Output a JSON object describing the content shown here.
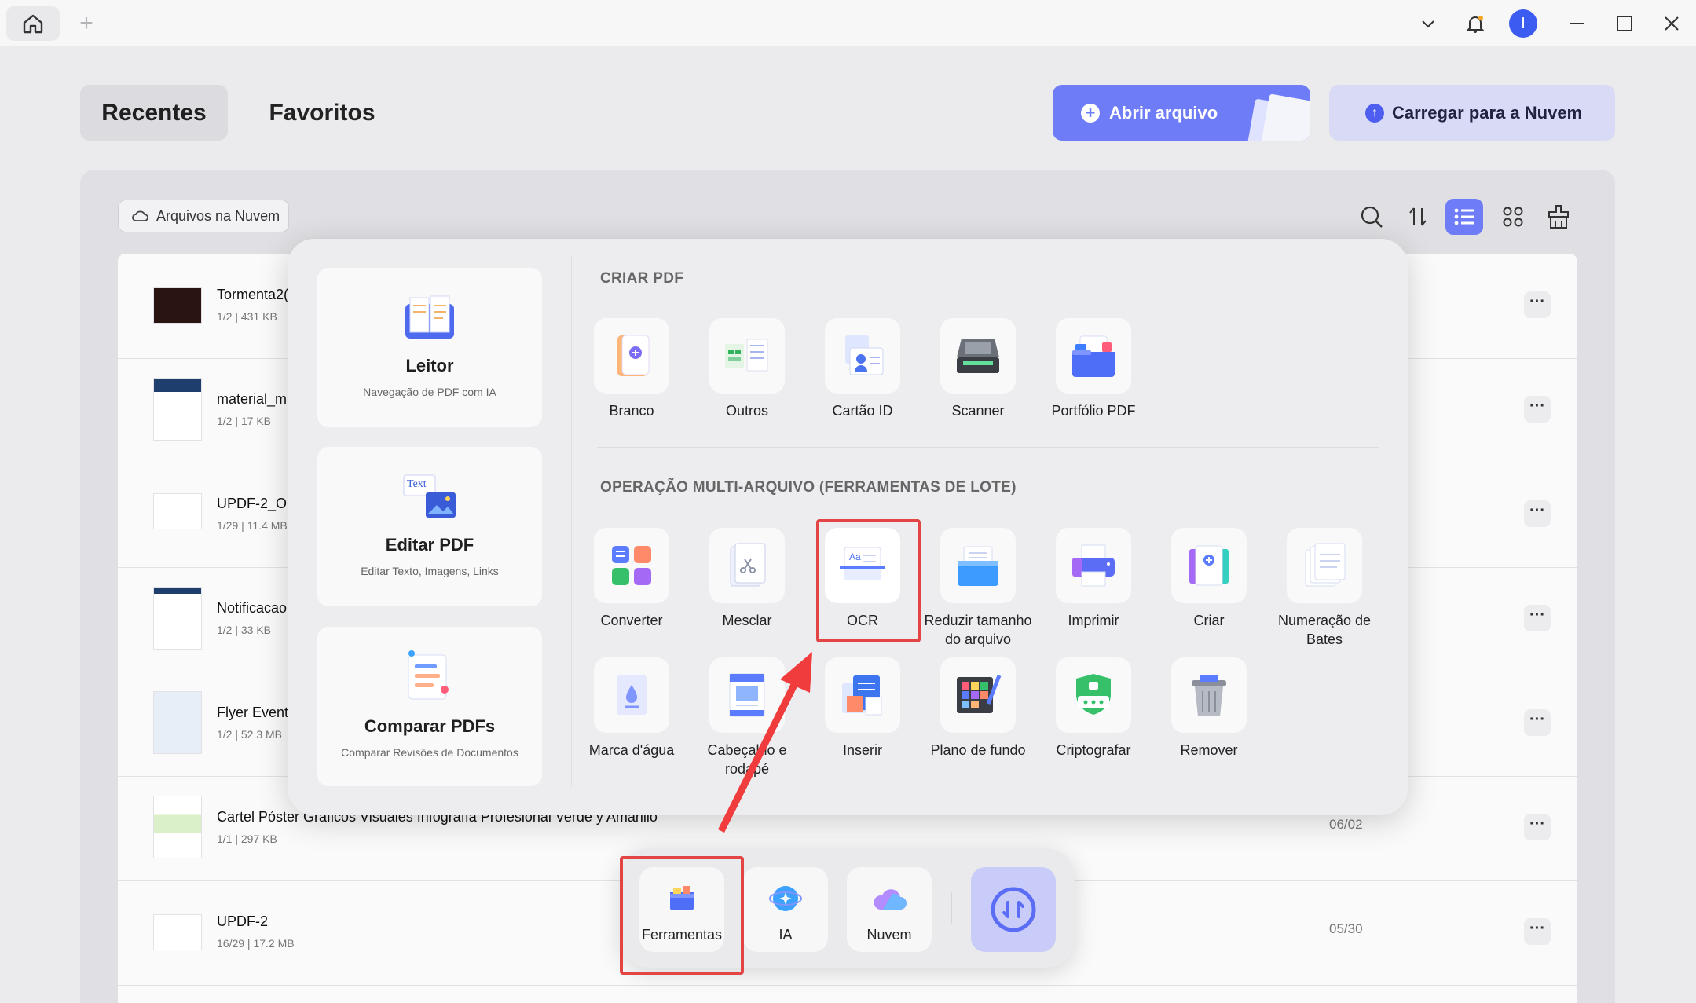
{
  "colors": {
    "accent": "#6e7cf7",
    "highlight_red": "#e34444",
    "cloud_button_bg": "#d9dbf6"
  },
  "topbar": {
    "avatar_letter": "I"
  },
  "header": {
    "tab_recent": "Recentes",
    "tab_favorites": "Favoritos",
    "open_file": "Abrir arquivo",
    "upload_cloud": "Carregar para a Nuvem"
  },
  "toolbar": {
    "cloud_files": "Arquivos na Nuvem"
  },
  "files": [
    {
      "name": "Tormenta2(",
      "meta": "1/2 | 431 KB",
      "date": ""
    },
    {
      "name": "material_m",
      "meta": "1/2 | 17 KB",
      "date": ""
    },
    {
      "name": "UPDF-2_OC",
      "meta": "1/29 | 11.4 MB",
      "date": ""
    },
    {
      "name": "Notificacao",
      "meta": "1/2 | 33 KB",
      "date": ""
    },
    {
      "name": "Flyer Evento",
      "meta": "1/2 | 52.3 MB",
      "date": ""
    },
    {
      "name": "Cartel Póster Gráficos Visuales Infografía Profesional Verde y Amarillo",
      "meta": "1/1 | 297 KB",
      "date": "06/02"
    },
    {
      "name": "UPDF-2",
      "meta": "16/29 | 17.2 MB",
      "date": "05/30"
    }
  ],
  "popup": {
    "cards": [
      {
        "title": "Leitor",
        "sub": "Navegação de PDF com IA"
      },
      {
        "title": "Editar PDF",
        "sub": "Editar Texto, Imagens, Links"
      },
      {
        "title": "Comparar PDFs",
        "sub": "Comparar Revisões de Documentos"
      }
    ],
    "create_title": "CRIAR PDF",
    "create_tools": [
      "Branco",
      "Outros",
      "Cartão ID",
      "Scanner",
      "Portfólio PDF"
    ],
    "batch_title": "OPERAÇÃO MULTI-ARQUIVO (FERRAMENTAS DE LOTE)",
    "batch_tools_row1": [
      "Converter",
      "Mesclar",
      "OCR",
      "Reduzir tamanho do arquivo",
      "Imprimir",
      "Criar",
      "Numeração de Bates"
    ],
    "batch_tools_row2": [
      "Marca d'água",
      "Cabeçalho e rodapé",
      "Inserir",
      "Plano de fundo",
      "Criptografar",
      "Remover"
    ],
    "edit_icon_text": "Text"
  },
  "dock": {
    "tools": "Ferramentas",
    "ai": "IA",
    "cloud": "Nuvem"
  }
}
